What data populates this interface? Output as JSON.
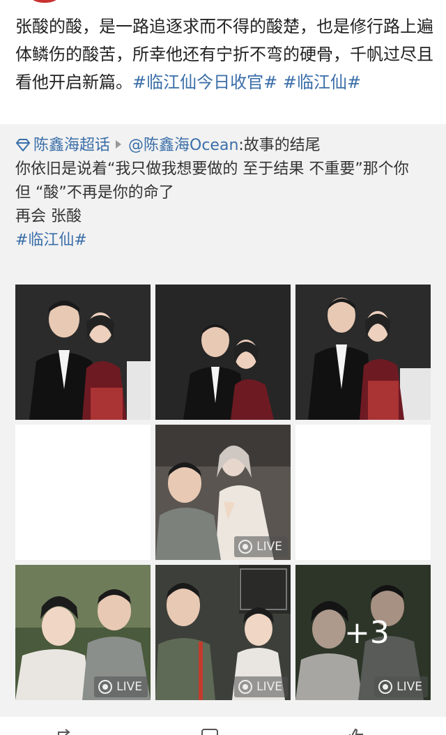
{
  "post": {
    "text_main": "张酸的酸，是一路追逐求而不得的酸楚，也是修行路上遍体鳞伤的酸苦，所幸他还有宁折不弯的硬骨，千帆过尽且看他开启新篇。",
    "hashtag_1": "#临江仙今日收官#",
    "hashtag_2": "#临江仙#"
  },
  "repost": {
    "supertopic": "陈鑫海超话",
    "mention": "@陈鑫海Ocean",
    "title_suffix": ":故事的结尾",
    "line_1": "你依旧是说着“我只做我想要做的  至于结果  不重要”那个你",
    "line_2": "但 “酸”不再是你的命了",
    "line_3": "再会 张酸",
    "hashtag": "#临江仙#"
  },
  "photos": [
    {
      "kind": "photo",
      "desc": "couple-formal"
    },
    {
      "kind": "photo",
      "desc": "couple-formal"
    },
    {
      "kind": "photo",
      "desc": "couple-formal"
    },
    {
      "kind": "blank"
    },
    {
      "kind": "photo",
      "live": true
    },
    {
      "kind": "blank"
    },
    {
      "kind": "photo",
      "live": true
    },
    {
      "kind": "photo",
      "live": true
    },
    {
      "kind": "photo",
      "live": true,
      "more": "+3"
    }
  ],
  "live_label": "LIVE",
  "more_label": "+3",
  "colors": {
    "link": "#3a6ea8",
    "repost_bg": "#f2f2f2"
  }
}
